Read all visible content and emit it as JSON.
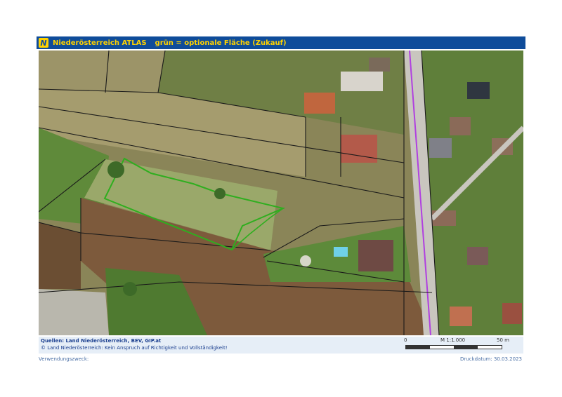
{
  "header": {
    "logo_letter": "N",
    "title": "Niederösterreich ATLAS",
    "subtitle": "grün = optionale Fläche (Zukauf)"
  },
  "map": {
    "highlight_color": "#2fae1f",
    "boundary_color": "#1a1a1a",
    "road_line_color": "#b040e0"
  },
  "footer": {
    "sources": "Quellen: Land Niederösterreich, BEV, GIP.at",
    "copyright": "© Land Niederösterreich: Kein Anspruch auf Richtigkeit und Vollständigkeit!",
    "scale": {
      "start_label": "0",
      "ratio_label": "M 1:1.000",
      "end_label": "50 m"
    }
  },
  "page": {
    "purpose_label": "Verwendungszweck:",
    "print_date": "Druckdatum: 30.03.2023"
  }
}
